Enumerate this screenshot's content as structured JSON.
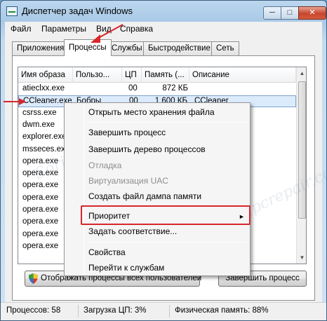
{
  "window": {
    "title": "Диспетчер задач Windows",
    "minimize_label": "─",
    "maximize_label": "□",
    "close_label": "✕"
  },
  "menu": {
    "items": [
      "Файл",
      "Параметры",
      "Вид",
      "Справка"
    ]
  },
  "tabs": [
    "Приложения",
    "Процессы",
    "Службы",
    "Быстродействие",
    "Сеть"
  ],
  "active_tab": "Процессы",
  "table": {
    "columns": [
      "Имя образа",
      "Пользо...",
      "ЦП",
      "Память (...",
      "Описание"
    ],
    "rows": [
      {
        "name": "atieclxx.exe",
        "user": "",
        "cpu": "00",
        "mem": "872 КБ",
        "desc": ""
      },
      {
        "name": "CCleaner.exe",
        "user": "Бобры",
        "cpu": "00",
        "mem": "1 600 КБ",
        "desc": "CCleaner"
      },
      {
        "name": "csrss.exe",
        "user": "",
        "cpu": "",
        "mem": "",
        "desc": ""
      },
      {
        "name": "dwm.exe",
        "user": "",
        "cpu": "",
        "mem": "",
        "desc": "он рабочего"
      },
      {
        "name": "explorer.exe",
        "user": "",
        "cpu": "",
        "mem": "",
        "desc": ""
      },
      {
        "name": "msseces.exe",
        "user": "",
        "cpu": "",
        "mem": "",
        "desc": "rity Client User"
      },
      {
        "name": "opera.exe",
        "user": "",
        "cpu": "",
        "mem": "",
        "desc": "Browser"
      },
      {
        "name": "opera.exe",
        "user": "",
        "cpu": "",
        "mem": "",
        "desc": "Browser"
      },
      {
        "name": "opera.exe",
        "user": "",
        "cpu": "",
        "mem": "",
        "desc": "Browser"
      },
      {
        "name": "opera.exe",
        "user": "",
        "cpu": "",
        "mem": "",
        "desc": "Browser"
      },
      {
        "name": "opera.exe",
        "user": "",
        "cpu": "",
        "mem": "",
        "desc": "Browser"
      },
      {
        "name": "opera.exe",
        "user": "",
        "cpu": "",
        "mem": "",
        "desc": "Browser"
      },
      {
        "name": "opera.exe",
        "user": "",
        "cpu": "",
        "mem": "",
        "desc": "Browser"
      },
      {
        "name": "opera.exe",
        "user": "",
        "cpu": "",
        "mem": "",
        "desc": "Browser"
      }
    ]
  },
  "context_menu": {
    "items": [
      {
        "label": "Открыть место хранения файла",
        "disabled": false
      },
      {
        "label": "Завершить процесс",
        "disabled": false
      },
      {
        "label": "Завершить дерево процессов",
        "disabled": false
      },
      {
        "label": "Отладка",
        "disabled": true
      },
      {
        "label": "Виртуализация UAC",
        "disabled": true
      },
      {
        "label": "Создать файл дампа памяти",
        "disabled": false
      },
      {
        "label": "Приоритет",
        "disabled": false,
        "submenu": true
      },
      {
        "label": "Задать соответствие...",
        "disabled": false
      },
      {
        "label": "Свойства",
        "disabled": false
      },
      {
        "label": "Перейти к службам",
        "disabled": false
      }
    ],
    "submenu_arrow": "►"
  },
  "buttons": {
    "show_all": "Отображать процессы всех пользователей",
    "end_process": "Завершить процесс"
  },
  "status": {
    "processes": "Процессов: 58",
    "cpu": "Загрузка ЦП: 3%",
    "memory": "Физическая память: 88%"
  },
  "watermark": "Soringpcrepair.com",
  "colors": {
    "annotation_red": "#d8262b",
    "selection": "#dcebfc"
  }
}
